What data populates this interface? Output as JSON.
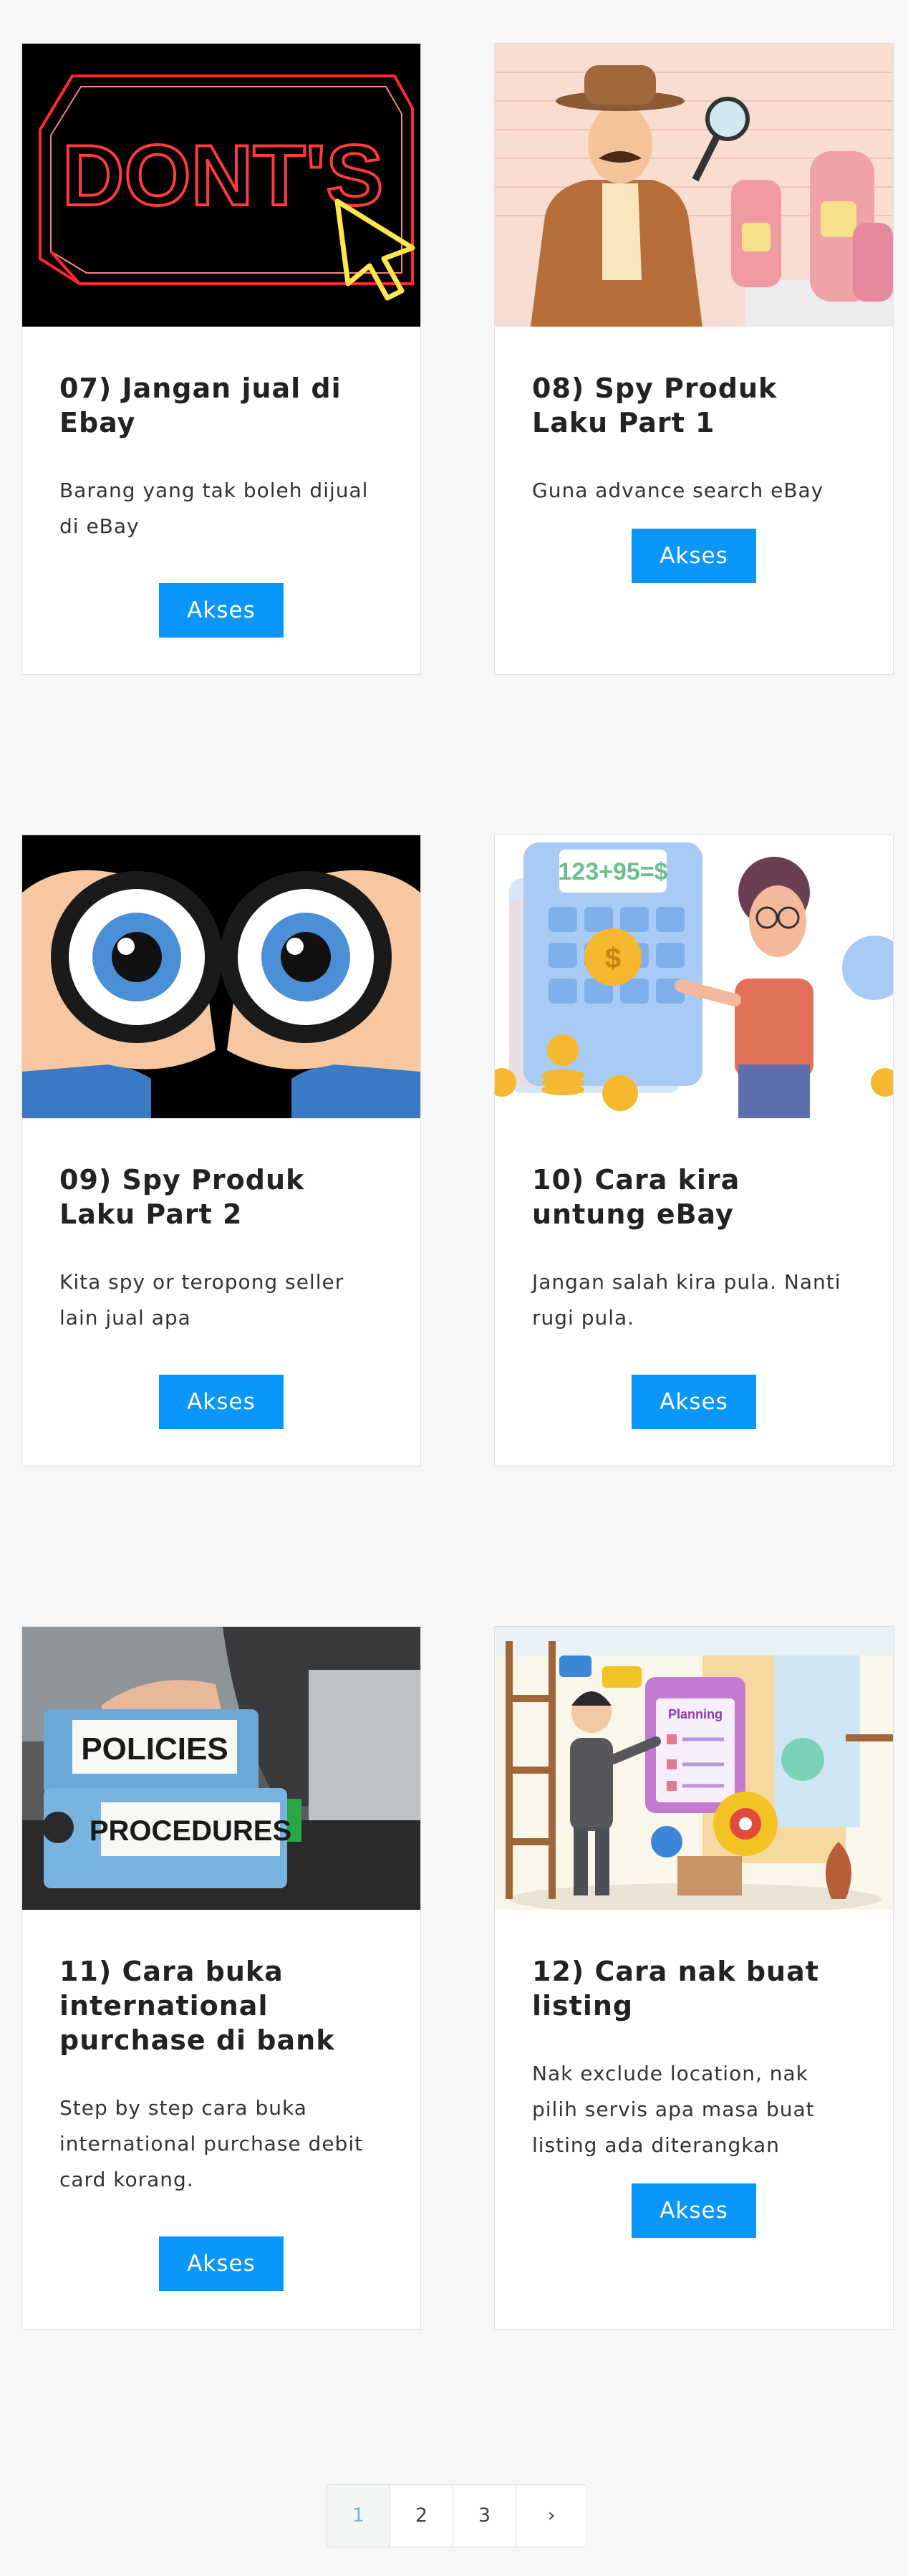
{
  "cards": [
    {
      "title": "07) Jangan jual di Ebay",
      "description": "Barang yang tak boleh dijual di eBay",
      "button_label": "Akses",
      "image_text": "DONT'S"
    },
    {
      "title": "08) Spy Produk Laku Part 1",
      "description": "Guna advance search eBay",
      "button_label": "Akses"
    },
    {
      "title": "09) Spy Produk Laku Part 2",
      "description": "Kita spy or teropong seller lain jual apa",
      "button_label": "Akses"
    },
    {
      "title": "10) Cara kira untung eBay",
      "description": "Jangan salah kira pula. Nanti rugi pula.",
      "button_label": "Akses",
      "image_text": "123+95=$"
    },
    {
      "title": "11) Cara buka international purchase di bank",
      "description": "Step by step cara buka international purchase debit card korang.",
      "button_label": "Akses",
      "image_text_1": "POLICIES",
      "image_text_2": "PROCEDURES"
    },
    {
      "title": "12) Cara nak buat listing",
      "description": "Nak exclude location, nak pilih servis apa masa buat listing ada diterangkan",
      "button_label": "Akses",
      "image_text": "Planning"
    }
  ],
  "pagination": {
    "pages": [
      "1",
      "2",
      "3"
    ],
    "current": "1",
    "next_icon": "chevron-right-icon",
    "next_glyph": "›"
  },
  "colors": {
    "accent": "#0a96fb",
    "background": "#f7f7f7",
    "active_page": "#7bb7cc"
  }
}
